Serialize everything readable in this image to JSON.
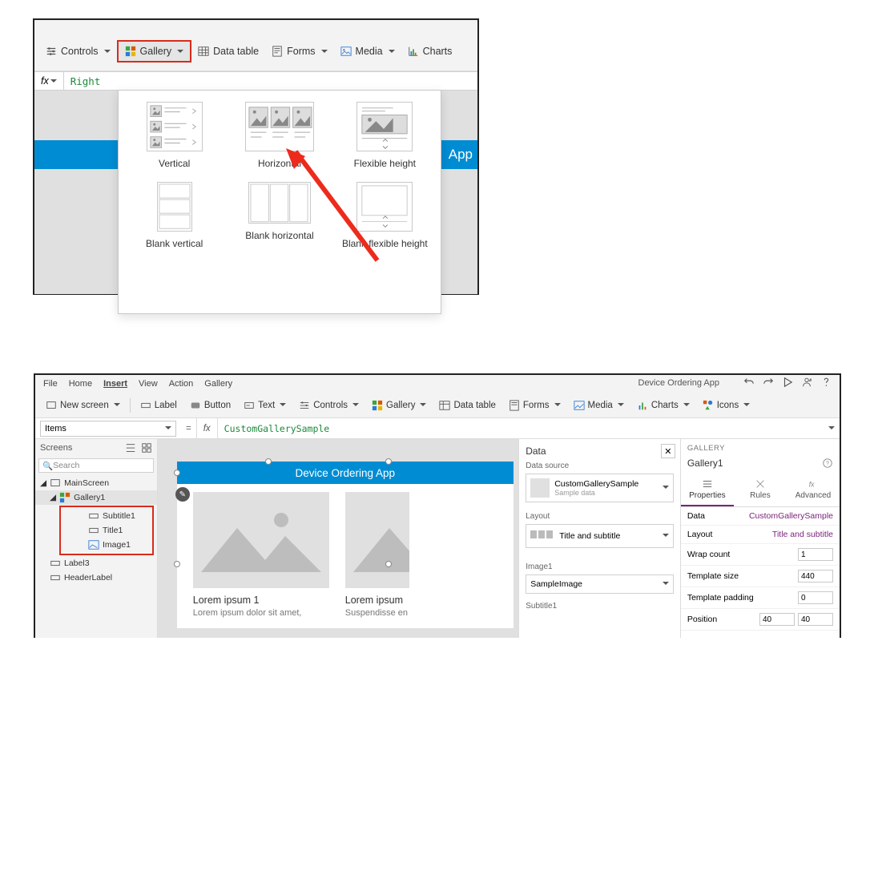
{
  "shot1": {
    "toolbar": {
      "controls": "Controls",
      "gallery": "Gallery",
      "datatable": "Data table",
      "forms": "Forms",
      "media": "Media",
      "charts": "Charts"
    },
    "fx": {
      "label": "fx",
      "value": "Right"
    },
    "bluebar": "App",
    "options": {
      "vertical": "Vertical",
      "horizontal": "Horizontal",
      "flexible": "Flexible height",
      "blankVertical": "Blank vertical",
      "blankHorizontal": "Blank horizontal",
      "blankFlexible": "Blank flexible height"
    }
  },
  "shot2": {
    "menu": {
      "file": "File",
      "home": "Home",
      "insert": "Insert",
      "view": "View",
      "action": "Action",
      "gallery": "Gallery"
    },
    "appTitle": "Device Ordering App",
    "ribbon": {
      "newscreen": "New screen",
      "label": "Label",
      "button": "Button",
      "text": "Text",
      "controls": "Controls",
      "gallery": "Gallery",
      "datatable": "Data table",
      "forms": "Forms",
      "media": "Media",
      "charts": "Charts",
      "icons": "Icons"
    },
    "fxbar": {
      "property": "Items",
      "eq": "=",
      "fx": "fx",
      "value": "CustomGallerySample"
    },
    "left": {
      "header": "Screens",
      "search": "Search",
      "mainscreen": "MainScreen",
      "gallery1": "Gallery1",
      "subtitle1": "Subtitle1",
      "title1": "Title1",
      "image1": "Image1",
      "label3": "Label3",
      "headerlabel": "HeaderLabel"
    },
    "canvas": {
      "header": "Device Ordering App",
      "cards": [
        {
          "title": "Lorem ipsum 1",
          "sub": "Lorem ipsum dolor sit amet,"
        },
        {
          "title": "Lorem ipsum",
          "sub": "Suspendisse en"
        }
      ]
    },
    "dataPane": {
      "title": "Data",
      "dsLabel": "Data source",
      "dsName": "CustomGallerySample",
      "dsSub": "Sample data",
      "layoutLabel": "Layout",
      "layoutVal": "Title and subtitle",
      "image1": "Image1",
      "image1Val": "SampleImage",
      "subtitle1": "Subtitle1"
    },
    "right": {
      "section": "GALLERY",
      "name": "Gallery1",
      "tabs": {
        "props": "Properties",
        "rules": "Rules",
        "adv": "Advanced"
      },
      "rows": {
        "data": {
          "label": "Data",
          "val": "CustomGallerySample"
        },
        "layout": {
          "label": "Layout",
          "val": "Title and subtitle"
        },
        "wrap": {
          "label": "Wrap count",
          "val": "1"
        },
        "tsize": {
          "label": "Template size",
          "val": "440"
        },
        "tpad": {
          "label": "Template padding",
          "val": "0"
        },
        "pos": {
          "label": "Position",
          "x": "40",
          "y": "40"
        }
      }
    }
  }
}
